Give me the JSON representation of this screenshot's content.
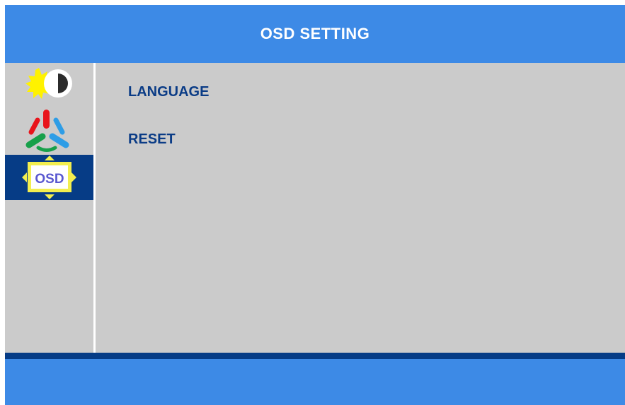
{
  "header": {
    "title": "OSD SETTING"
  },
  "sidebar": {
    "items": [
      {
        "icon": "brightness-contrast-icon",
        "active": false
      },
      {
        "icon": "color-rgb-icon",
        "active": false
      },
      {
        "icon": "osd-settings-icon",
        "label": "OSD",
        "active": true
      }
    ]
  },
  "menu": {
    "items": [
      {
        "label": "LANGUAGE"
      },
      {
        "label": "RESET"
      }
    ]
  },
  "colors": {
    "header_bg": "#3d8ae6",
    "panel_bg": "#cbcbcb",
    "active_bg": "#063c86",
    "menu_text": "#0b3c86"
  }
}
